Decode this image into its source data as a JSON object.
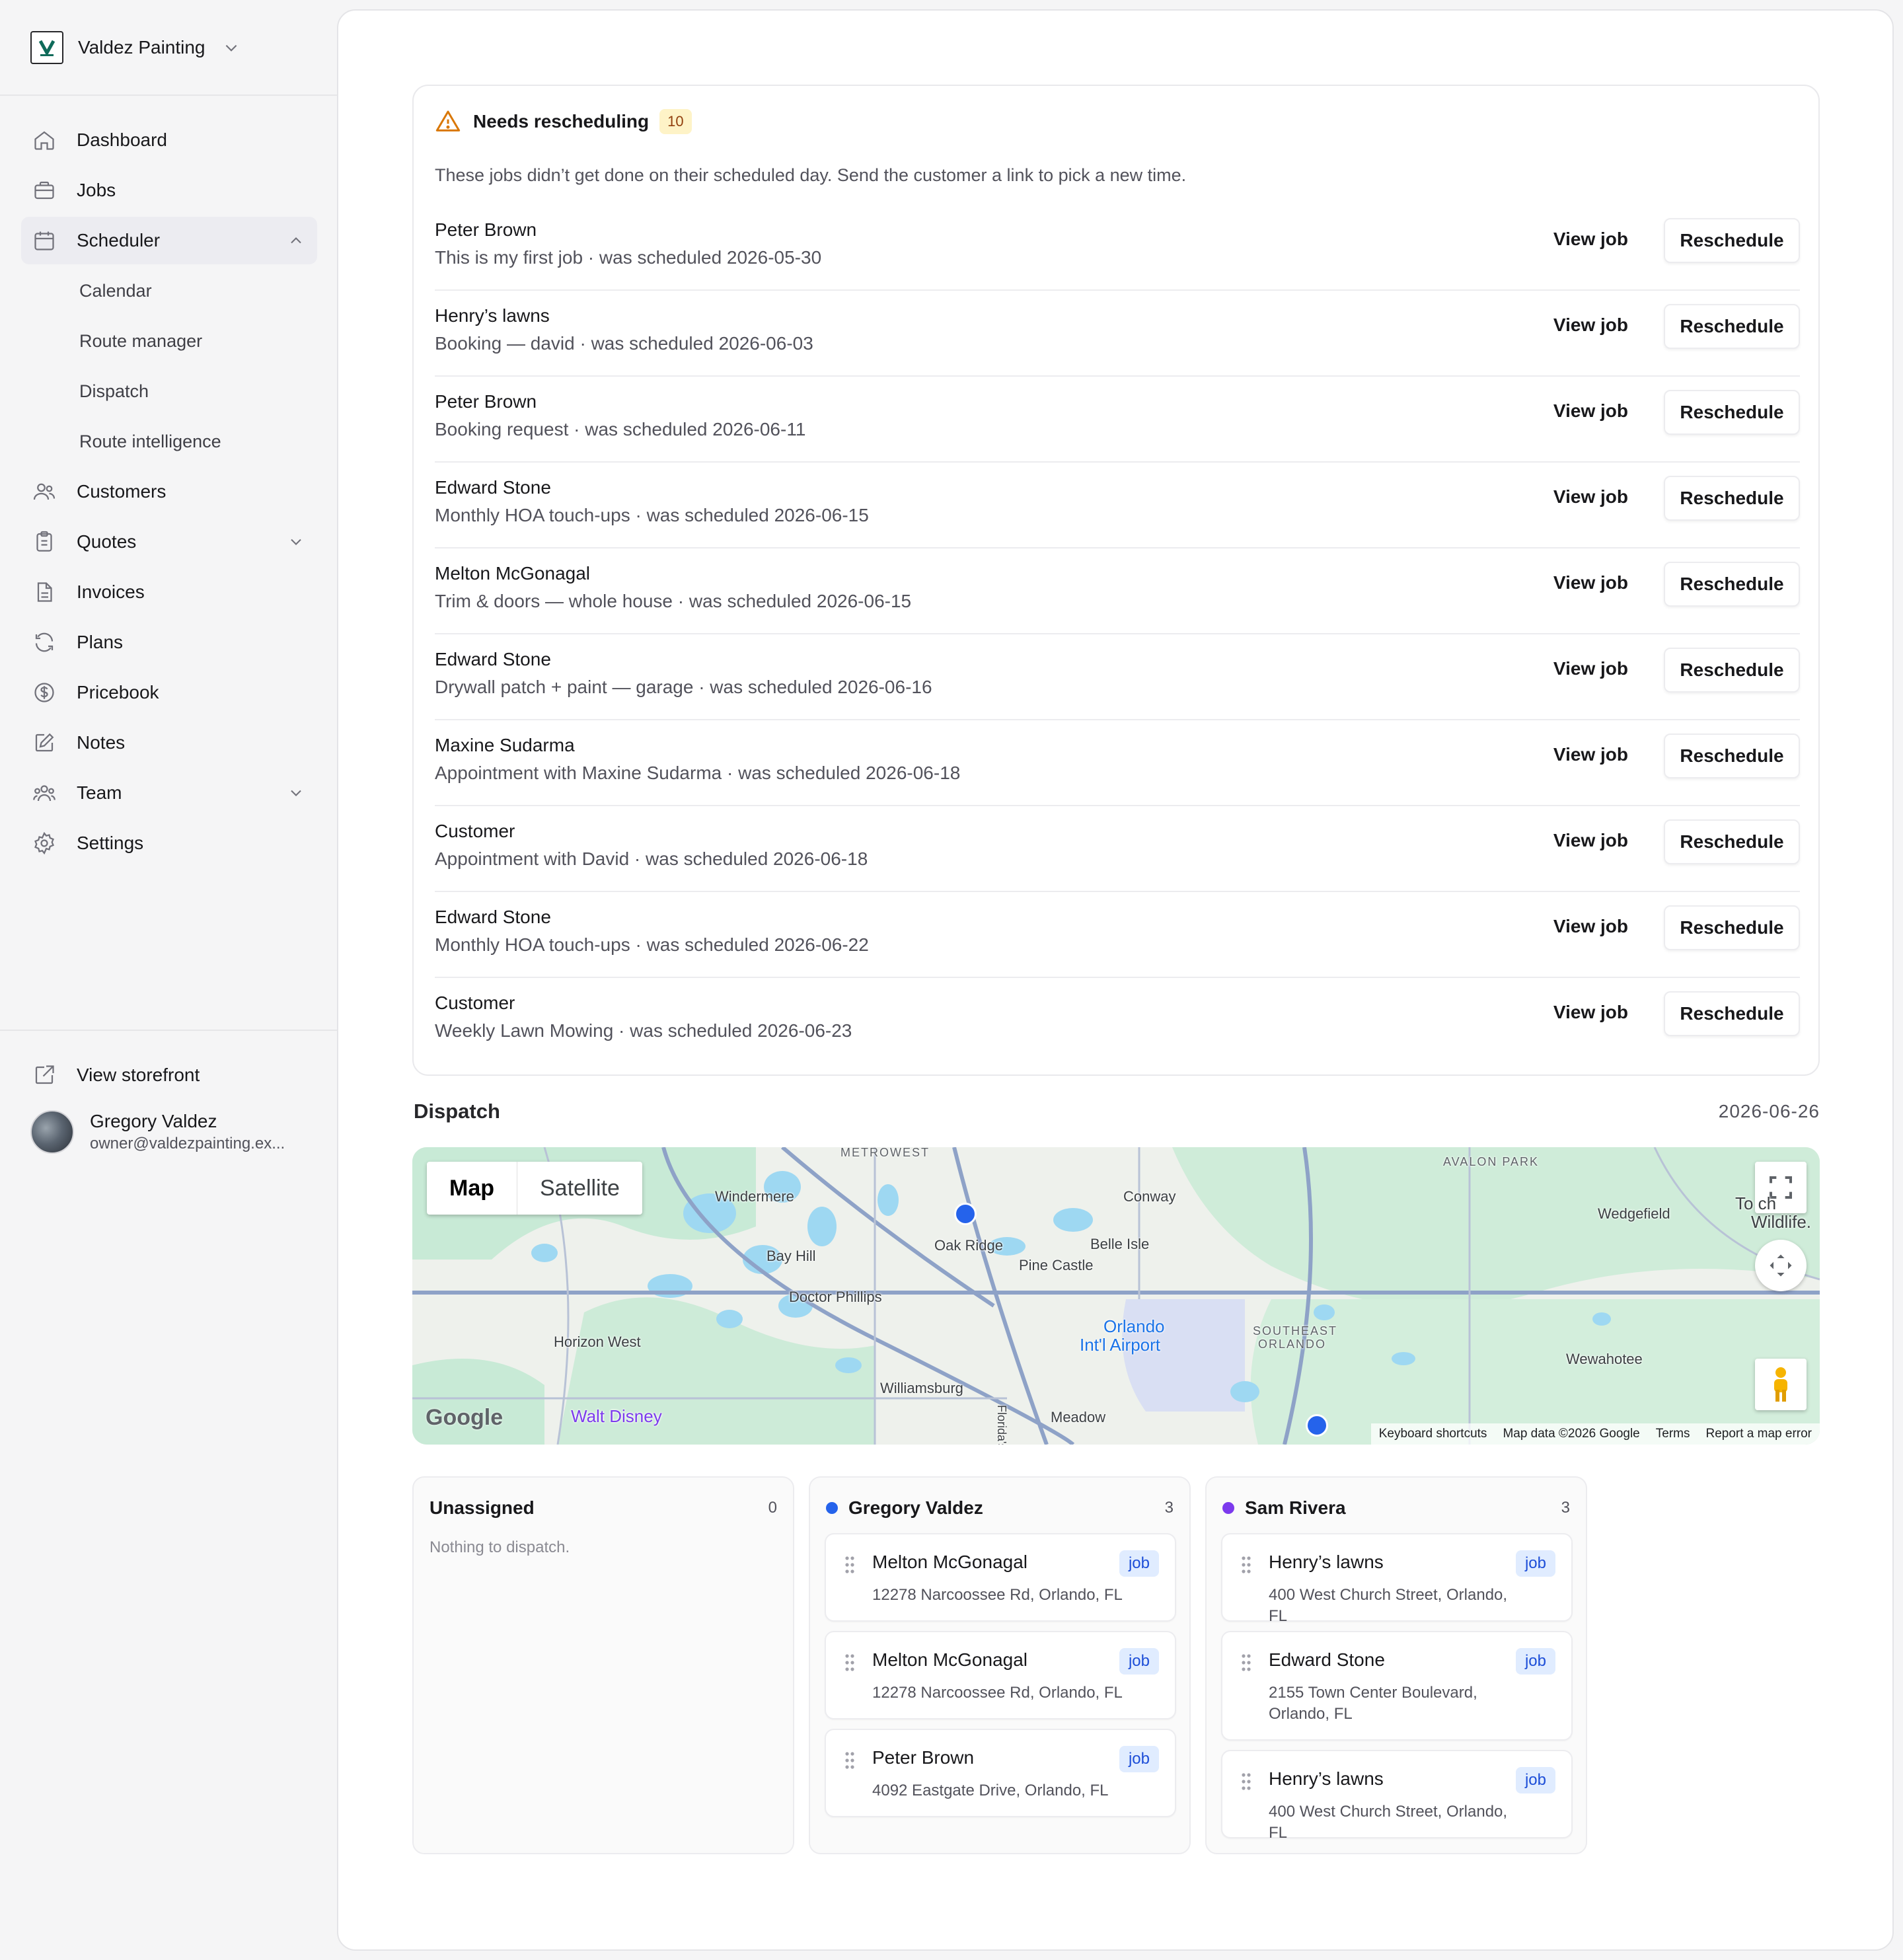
{
  "brand": {
    "name": "Valdez Painting"
  },
  "nav": {
    "items": [
      {
        "label": "Dashboard"
      },
      {
        "label": "Jobs"
      },
      {
        "label": "Scheduler"
      },
      {
        "label": "Customers"
      },
      {
        "label": "Quotes"
      },
      {
        "label": "Invoices"
      },
      {
        "label": "Plans"
      },
      {
        "label": "Pricebook"
      },
      {
        "label": "Notes"
      },
      {
        "label": "Team"
      },
      {
        "label": "Settings"
      }
    ],
    "scheduler_sub": [
      {
        "label": "Calendar"
      },
      {
        "label": "Route manager"
      },
      {
        "label": "Dispatch"
      },
      {
        "label": "Route intelligence"
      }
    ],
    "storefront": "View storefront"
  },
  "user": {
    "name": "Gregory Valdez",
    "email": "owner@valdezpainting.ex..."
  },
  "reschedule": {
    "title": "Needs rescheduling",
    "count": "10",
    "description": "These jobs didn’t get done on their scheduled day. Send the customer a link to pick a new time.",
    "view_label": "View job",
    "reschedule_label": "Reschedule",
    "rows": [
      {
        "name": "Peter Brown",
        "detail": "This is my first job · was scheduled 2026-05-30"
      },
      {
        "name": "Henry’s lawns",
        "detail": "Booking — david · was scheduled 2026-06-03"
      },
      {
        "name": "Peter Brown",
        "detail": "Booking request · was scheduled 2026-06-11"
      },
      {
        "name": "Edward Stone",
        "detail": "Monthly HOA touch-ups · was scheduled 2026-06-15"
      },
      {
        "name": "Melton McGonagal",
        "detail": "Trim & doors — whole house · was scheduled 2026-06-15"
      },
      {
        "name": "Edward Stone",
        "detail": "Drywall patch + paint — garage · was scheduled 2026-06-16"
      },
      {
        "name": "Maxine Sudarma",
        "detail": "Appointment with Maxine Sudarma · was scheduled 2026-06-18"
      },
      {
        "name": "Customer",
        "detail": "Appointment with David · was scheduled 2026-06-18"
      },
      {
        "name": "Edward Stone",
        "detail": "Monthly HOA touch-ups · was scheduled 2026-06-22"
      },
      {
        "name": "Customer",
        "detail": "Weekly Lawn Mowing · was scheduled 2026-06-23"
      }
    ]
  },
  "dispatch": {
    "title": "Dispatch",
    "date": "2026-06-26",
    "map": {
      "tab_map": "Map",
      "tab_satellite": "Satellite",
      "google": "Google",
      "labels": {
        "windermere": "Windermere",
        "bay_hill": "Bay Hill",
        "oak_ridge": "Oak Ridge",
        "doctor_phillips": "Doctor Phillips",
        "horizon_west": "Horizon West",
        "williamsburg": "Williamsburg",
        "conway": "Conway",
        "belle_isle": "Belle Isle",
        "pine_castle": "Pine Castle",
        "orlando_airport_1": "Orlando",
        "orlando_airport_2": "Int'l Airport",
        "southeast_orlando_1": "SOUTHEAST",
        "southeast_orlando_2": "ORLANDO",
        "avalon_park": "AVALON PARK",
        "metrowest": "METROWEST",
        "wedgefield": "Wedgefield",
        "wewahotee": "Wewahotee",
        "meadow_woods": "Meadow",
        "walt_disney": "Walt Disney",
        "florida_tpke": "Florida's Tpke",
        "wildlife": "Wildlife.",
        "toch": "To ch"
      },
      "footer": {
        "shortcuts": "Keyboard shortcuts",
        "data": "Map data ©2026 Google",
        "terms": "Terms",
        "report": "Report a map error"
      }
    },
    "job_tag": "job",
    "columns": [
      {
        "name": "Unassigned",
        "count": "0",
        "empty": "Nothing to dispatch.",
        "color": ""
      },
      {
        "name": "Gregory Valdez",
        "count": "3",
        "color": "#2563eb",
        "cards": [
          {
            "title": "Melton McGonagal",
            "address": "12278 Narcoossee Rd, Orlando, FL"
          },
          {
            "title": "Melton McGonagal",
            "address": "12278 Narcoossee Rd, Orlando, FL"
          },
          {
            "title": "Peter Brown",
            "address": "4092 Eastgate Drive, Orlando, FL"
          }
        ]
      },
      {
        "name": "Sam Rivera",
        "count": "3",
        "color": "#7c3aed",
        "cards": [
          {
            "title": "Henry’s lawns",
            "address": "400 West Church Street, Orlando, FL"
          },
          {
            "title": "Edward Stone",
            "address": "2155 Town Center Boulevard, Orlando, FL"
          },
          {
            "title": "Henry’s lawns",
            "address": "400 West Church Street, Orlando, FL"
          }
        ]
      }
    ]
  },
  "colors": {
    "accent": "#2563eb",
    "warning": "#d97706",
    "purple": "#7c3aed"
  }
}
